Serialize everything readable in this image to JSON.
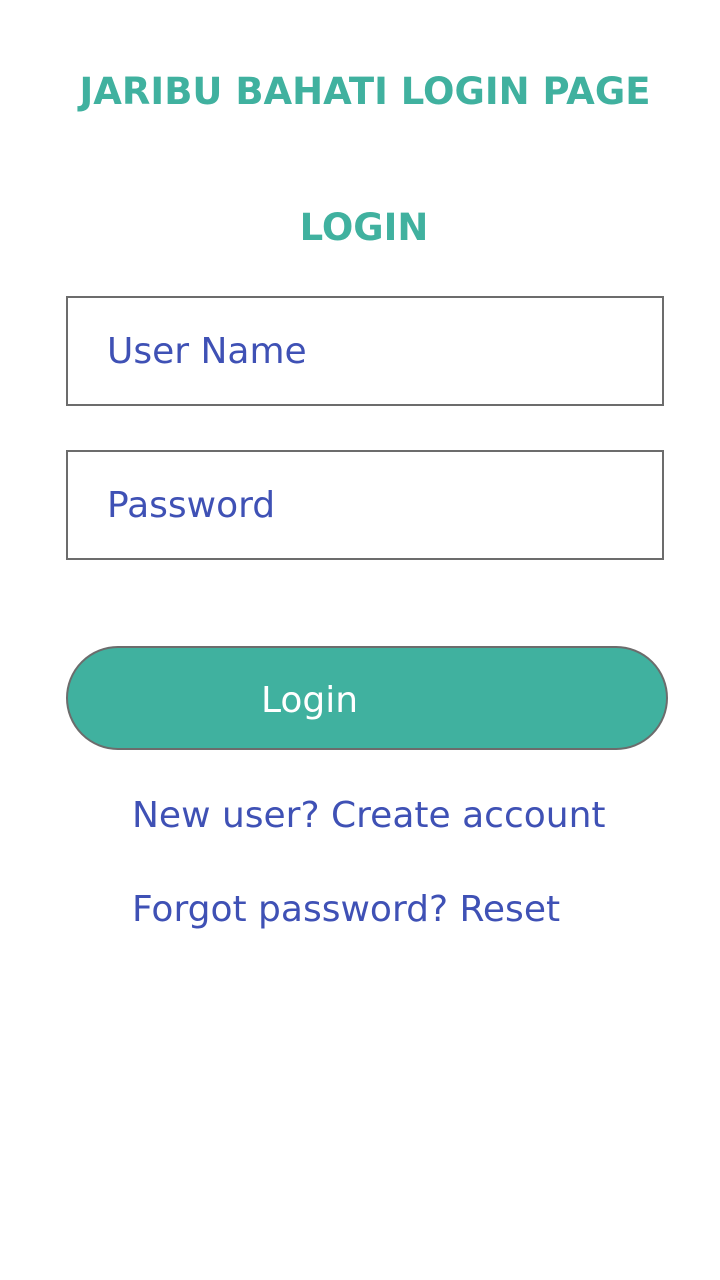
{
  "header": {
    "title": "JARIBU BAHATI LOGIN PAGE"
  },
  "form": {
    "heading": "LOGIN",
    "username": {
      "value": "",
      "placeholder": "User Name"
    },
    "password": {
      "value": "",
      "placeholder": "Password"
    },
    "submit_label": "Login"
  },
  "links": {
    "create_account": "New user? Create account",
    "reset_password": "Forgot password? Reset"
  },
  "colors": {
    "accent": "#40b19f",
    "link": "#3f51b5",
    "border": "#6c6c6c",
    "background": "#ffffff"
  }
}
